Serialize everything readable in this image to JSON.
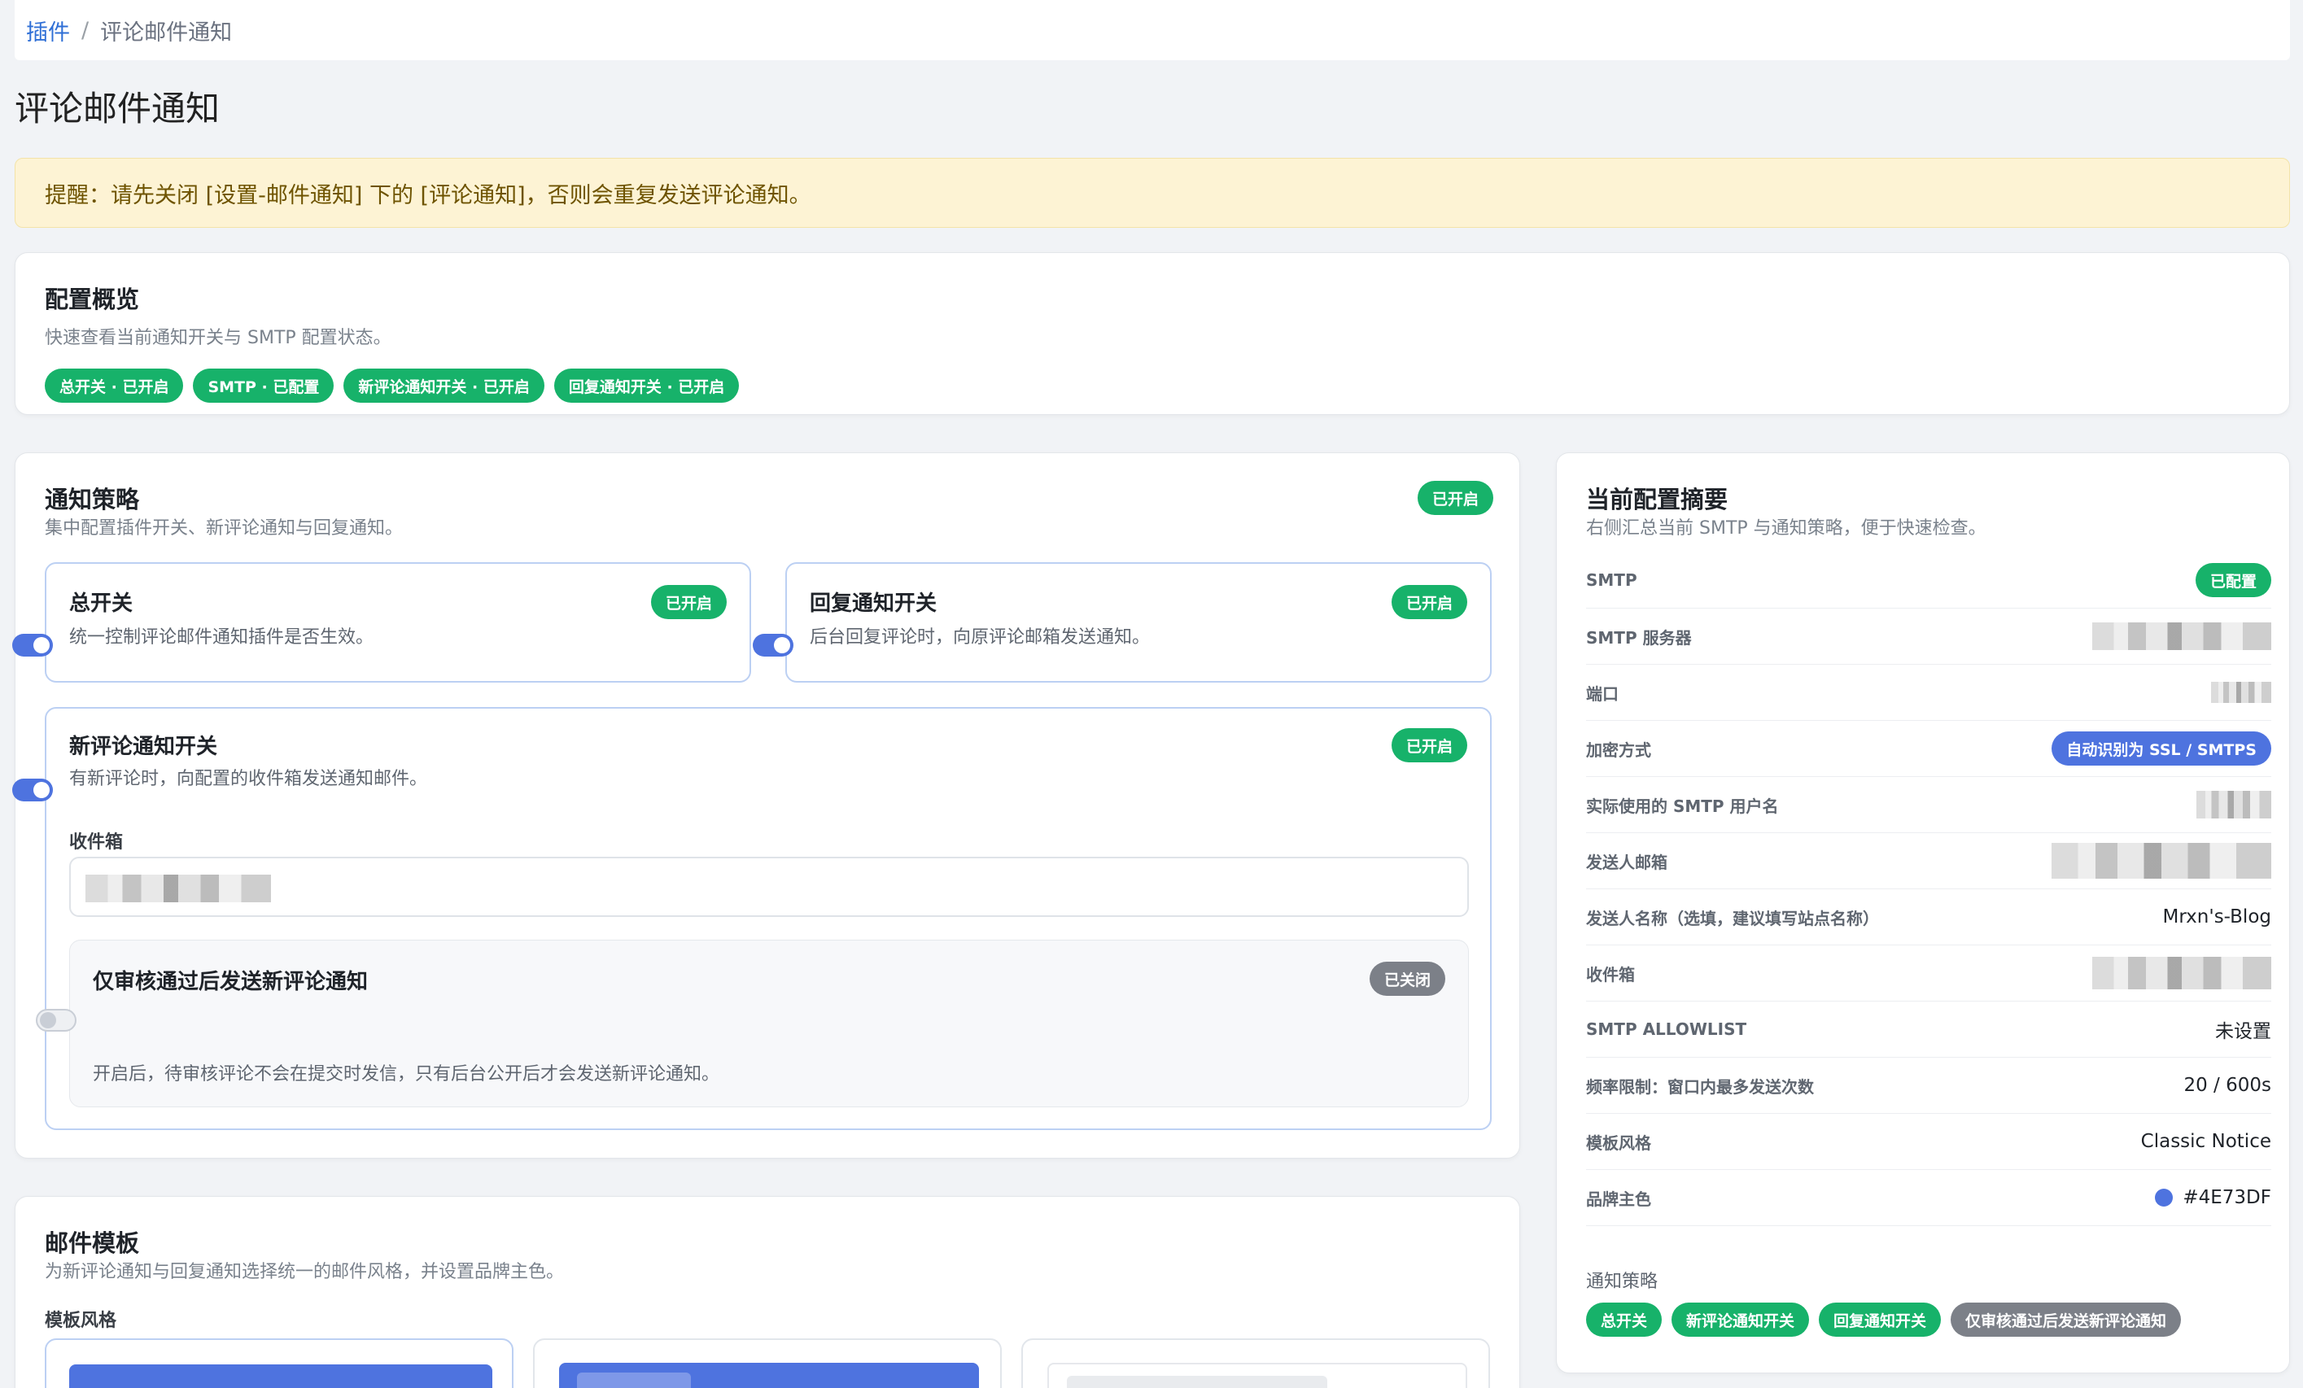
{
  "breadcrumb": {
    "root": "插件",
    "separator": "/",
    "current": "评论邮件通知"
  },
  "page_title": "评论邮件通知",
  "warning": "提醒：请先关闭 [设置-邮件通知] 下的 [评论通知]，否则会重复发送评论通知。",
  "overview": {
    "title": "配置概览",
    "subtitle": "快速查看当前通知开关与 SMTP 配置状态。",
    "badges": [
      "总开关 · 已开启",
      "SMTP · 已配置",
      "新评论通知开关 · 已开启",
      "回复通知开关 · 已开启"
    ]
  },
  "strategy": {
    "title": "通知策略",
    "subtitle": "集中配置插件开关、新评论通知与回复通知。",
    "status": "已开启",
    "master": {
      "title": "总开关",
      "desc": "统一控制评论邮件通知插件是否生效。",
      "status": "已开启",
      "on": true
    },
    "reply": {
      "title": "回复通知开关",
      "desc": "后台回复评论时，向原评论邮箱发送通知。",
      "status": "已开启",
      "on": true
    },
    "new_comment": {
      "title": "新评论通知开关",
      "desc": "有新评论时，向配置的收件箱发送通知邮件。",
      "status": "已开启",
      "on": true,
      "inbox_label": "收件箱",
      "approve_only": {
        "title": "仅审核通过后发送新评论通知",
        "status": "已关闭",
        "on": false,
        "desc": "开启后，待审核评论不会在提交时发信，只有后台公开后才会发送新评论通知。"
      }
    }
  },
  "template": {
    "title": "邮件模板",
    "subtitle": "为新评论通知与回复通知选择统一的邮件风格，并设置品牌主色。",
    "style_label": "模板风格"
  },
  "summary": {
    "title": "当前配置摘要",
    "subtitle": "右侧汇总当前 SMTP 与通知策略，便于快速检查。",
    "rows": [
      {
        "key": "SMTP",
        "value": "已配置"
      },
      {
        "key": "SMTP 服务器",
        "value": ""
      },
      {
        "key": "端口",
        "value": ""
      },
      {
        "key": "加密方式",
        "value": "自动识别为 SSL / SMTPS"
      },
      {
        "key": "实际使用的 SMTP 用户名",
        "value": ""
      },
      {
        "key": "发送人邮箱",
        "value": ""
      },
      {
        "key": "发送人名称（选填，建议填写站点名称）",
        "value": "Mrxn's-Blog"
      },
      {
        "key": "收件箱",
        "value": ""
      },
      {
        "key": "SMTP ALLOWLIST",
        "value": "未设置"
      },
      {
        "key": "频率限制：窗口内最多发送次数",
        "value": "20 / 600s"
      },
      {
        "key": "模板风格",
        "value": "Classic Notice"
      },
      {
        "key": "品牌主色",
        "value": "#4E73DF"
      }
    ],
    "policy_label": "通知策略",
    "policy_badges": [
      "总开关",
      "新评论通知开关",
      "回复通知开关",
      "仅审核通过后发送新评论通知"
    ]
  },
  "colors": {
    "brand": "#4E73DF",
    "success": "#17b26a",
    "muted": "#7c8088",
    "warning_bg": "#fdf3d4"
  }
}
